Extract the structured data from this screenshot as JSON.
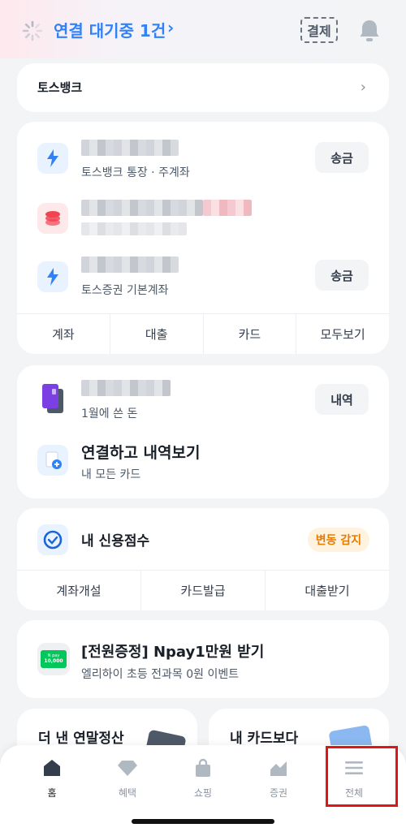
{
  "header": {
    "connection_status": "연결 대기중 1건",
    "pay_label": "결제",
    "icons": {
      "spinner": "loading-spinner-icon",
      "bell": "bell-icon"
    }
  },
  "tossbank_card": {
    "label": "토스뱅크"
  },
  "accounts": [
    {
      "name_hidden": true,
      "subtitle": "토스뱅크 통장 · 주계좌",
      "action": "송금",
      "icon": "toss-logo-icon"
    },
    {
      "name_hidden": true,
      "subtitle": "",
      "action": "",
      "icon": "coin-stack-icon"
    },
    {
      "name_hidden": true,
      "subtitle": "토스증권 기본계좌",
      "action": "송금",
      "icon": "toss-logo-icon"
    }
  ],
  "account_tabs": [
    "계좌",
    "대출",
    "카드",
    "모두보기"
  ],
  "spending": {
    "subtitle": "1월에 쓴 돈",
    "action": "내역",
    "connect_title": "연결하고 내역보기",
    "connect_subtitle": "내 모든 카드"
  },
  "credit": {
    "title": "내 신용점수",
    "badge": "변동 감지",
    "tabs": [
      "계좌개설",
      "카드발급",
      "대출받기"
    ]
  },
  "event": {
    "title": "[전원증정] Npay1만원 받기",
    "subtitle": "엘리하이 초등 전과목 0원 이벤트",
    "coupon_text": "10,000",
    "coupon_brand": "N pay"
  },
  "promo_cards": [
    {
      "title": "더 낸 연말정산"
    },
    {
      "title": "내 카드보다"
    }
  ],
  "bottom_nav": [
    {
      "label": "홈",
      "icon": "home-icon",
      "active": true
    },
    {
      "label": "혜택",
      "icon": "diamond-icon",
      "active": false
    },
    {
      "label": "쇼핑",
      "icon": "shopping-bag-icon",
      "active": false
    },
    {
      "label": "증권",
      "icon": "stock-chart-icon",
      "active": false
    },
    {
      "label": "전체",
      "icon": "menu-icon",
      "active": false,
      "highlighted": true
    }
  ],
  "colors": {
    "accent": "#3182f6",
    "highlight": "#e01515",
    "badge": "#e57c00"
  }
}
